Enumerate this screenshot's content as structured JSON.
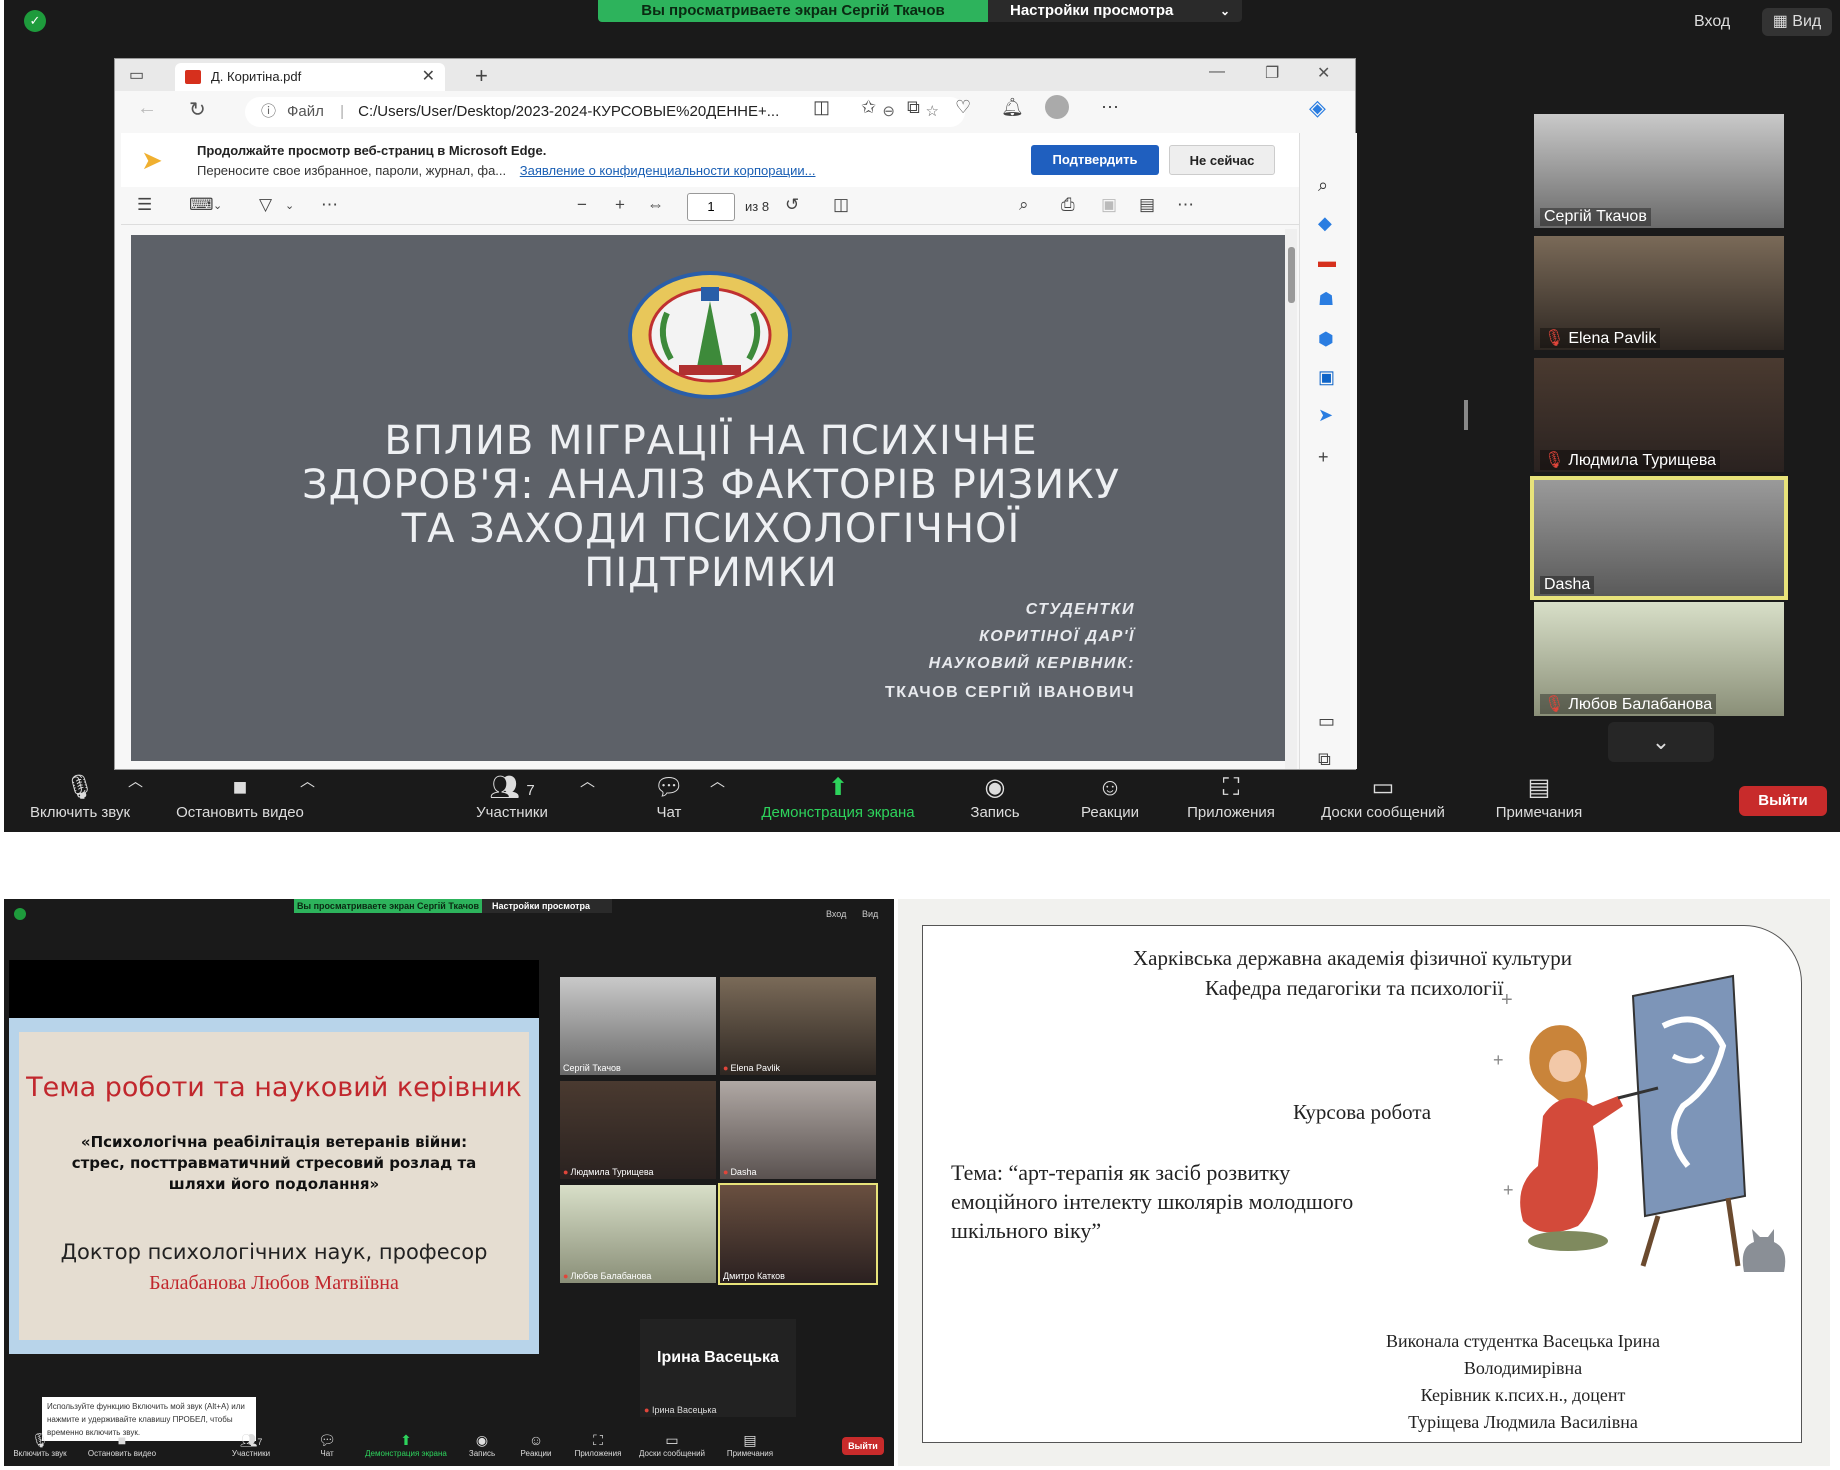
{
  "top_meeting": {
    "share_banner": "Вы просматриваете экран Сергій Ткачов",
    "view_options": "Настройки просмотра",
    "top_right": {
      "signin": "Вход",
      "view": "Вид"
    },
    "browser": {
      "tab_title": "Д. Коритіна.pdf",
      "address_label": "Файл",
      "address": "C:/Users/User/Desktop/2023-2024-КУРСОВЫЕ%20ДЕННЕ+...",
      "notice_title": "Продолжайте просмотр веб-страниц в Microsoft Edge.",
      "notice_body": "Переносите свое избранное, пароли, журнал, фа...",
      "notice_link": "Заявление о конфиденциальности корпорации...",
      "confirm_label": "Подтвердить",
      "not_now_label": "Не сейчас",
      "page_current": "1",
      "page_total": "из 8"
    },
    "slide": {
      "title_lines": [
        "ВПЛИВ МІГРАЦІЇ НА ПСИХІЧНЕ",
        "ЗДОРОВ'Я: АНАЛІЗ ФАКТОРІВ РИЗИКУ",
        "ТА ЗАХОДИ ПСИХОЛОГІЧНОЇ",
        "ПІДТРИМКИ"
      ],
      "role1": "СТУДЕНТКИ",
      "student": "КОРИТІНОЇ ДАР'Ї",
      "role2": "НАУКОВИЙ КЕРІВНИК:",
      "supervisor": "ТКАЧОВ СЕРГІЙ ІВАНОВИЧ"
    },
    "participants": [
      {
        "name": "Сергій Ткачов",
        "muted": false,
        "active": false
      },
      {
        "name": "Elena Pavlik",
        "muted": true,
        "active": false
      },
      {
        "name": "Людмила Турищева",
        "muted": true,
        "active": false
      },
      {
        "name": "Dasha",
        "muted": false,
        "active": true
      },
      {
        "name": "Любов Балабанова",
        "muted": true,
        "active": false
      }
    ],
    "toolbar": {
      "unmute": "Включить звук",
      "stop_video": "Остановить видео",
      "participants": "Участники",
      "participants_count": "7",
      "chat": "Чат",
      "share": "Демонстрация экрана",
      "record": "Запись",
      "reactions": "Реакции",
      "apps": "Приложения",
      "whiteboards": "Доски сообщений",
      "notes": "Примечания",
      "leave": "Выйти"
    }
  },
  "bottom_meeting": {
    "share_banner": "Вы просматриваете экран Сергій Ткачов",
    "view_options": "Настройки просмотра",
    "top_right": {
      "signin": "Вход",
      "view": "Вид"
    },
    "slide": {
      "title": "Тема роботи та науковий керівник",
      "theme": "«Психологічна реабілітація ветеранів війни: стрес, посттравматичний стресовий розлад та шляхи його подолання»",
      "degree": "Доктор психологічних наук, професор",
      "name": "Балабанова Любов Матвіївна"
    },
    "participants": [
      {
        "name": "Сергій Ткачов",
        "muted": false,
        "active": false
      },
      {
        "name": "Elena Pavlik",
        "muted": true,
        "active": false
      },
      {
        "name": "Людмила Турищева",
        "muted": true,
        "active": false
      },
      {
        "name": "Dasha",
        "muted": true,
        "active": false
      },
      {
        "name": "Любов Балабанова",
        "muted": true,
        "active": false
      },
      {
        "name": "Дмитро Катков",
        "muted": false,
        "active": true
      }
    ],
    "camera_off_participant": {
      "display": "Ірина Васецька",
      "label": "Ірина Васецька"
    },
    "tooltip": "Используйте функцию Включить мой звук (Alt+A) или нажмите и удерживайте клавишу ПРОБЕЛ, чтобы временно включить звук.",
    "toolbar": {
      "unmute": "Включить звук",
      "stop_video": "Остановить видео",
      "participants": "Участники",
      "participants_count": "7",
      "chat": "Чат",
      "share": "Демонстрация экрана",
      "record": "Запись",
      "reactions": "Реакции",
      "apps": "Приложения",
      "whiteboards": "Доски сообщений",
      "notes": "Примечания",
      "leave": "Выйти"
    }
  },
  "course_slide": {
    "academy": "Харківська державна академія фізичної культури",
    "department": "Кафедра педагогіки та психології",
    "work_type": "Курсова робота",
    "theme_lines": [
      "Тема:  “арт-терапія як засіб  розвитку",
      "емоційного  інтелекту  школярів молодшого",
      "шкільного віку”"
    ],
    "author_lines": [
      "Виконала  студентка  Васецька  Ірина",
      "Володимирівна",
      "Керівник  к.псих.н., доцент",
      "Туріщева Людмила  Василівна"
    ]
  }
}
